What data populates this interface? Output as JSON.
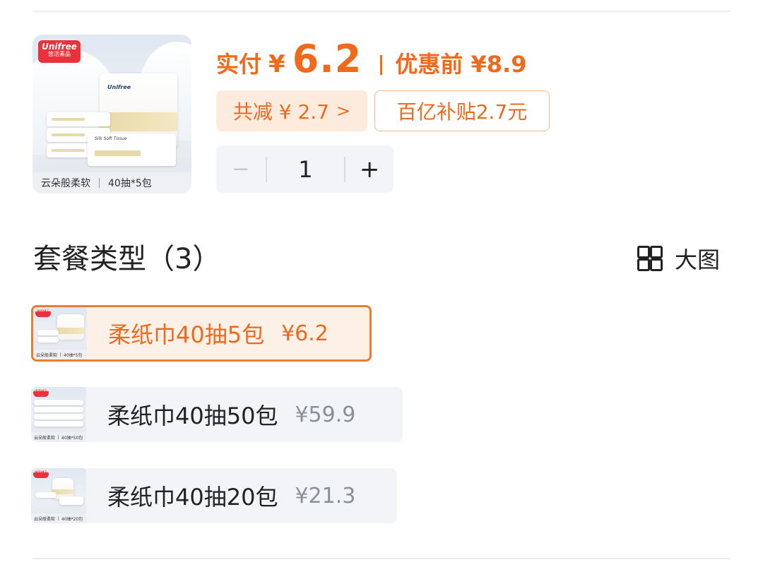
{
  "product": {
    "brand": "Unifree",
    "brand_sub": "悠活素品",
    "bag_word": "Unifree",
    "pack_text": "Silk Soft Tissue",
    "caption_left": "云朵般柔软",
    "caption_right": "40抽*5包"
  },
  "price": {
    "label": "实付",
    "currency": "¥",
    "amount": "6.2",
    "before": "优惠前 ¥8.9"
  },
  "discount": {
    "text": "共减 ¥ 2.7",
    "chevron": ">"
  },
  "subsidy": "百亿补贴2.7元",
  "stepper": {
    "minus": "−",
    "quantity": "1",
    "plus": "+"
  },
  "package": {
    "title": "套餐类型（3）",
    "big_view_label": "大图",
    "options": [
      {
        "name": "柔纸巾40抽5包",
        "price": "¥6.2",
        "caption_left": "云朵般柔软",
        "caption_right": "40抽*5包",
        "selected": true
      },
      {
        "name": "柔纸巾40抽50包",
        "price": "¥59.9",
        "caption_left": "云朵般柔软",
        "caption_right": "40抽*50包",
        "selected": false
      },
      {
        "name": "柔纸巾40抽20包",
        "price": "¥21.3",
        "caption_left": "云朵般柔软",
        "caption_right": "40抽*20包",
        "selected": false
      }
    ]
  },
  "colors": {
    "accent": "#f06a1b",
    "discount_bg": "#fdebdd",
    "selected_border": "#f07d2e",
    "muted_price": "#8a8f99",
    "chip_bg": "#f2f4f7"
  }
}
